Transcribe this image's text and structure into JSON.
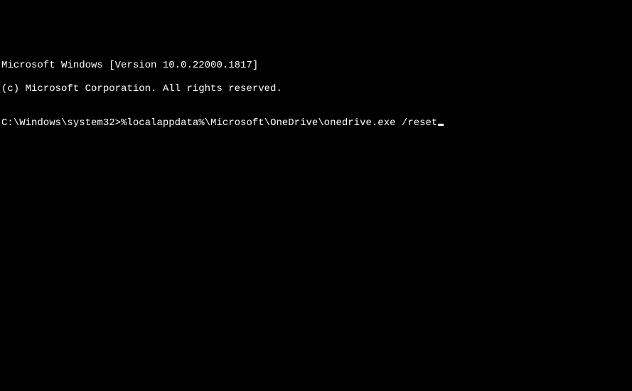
{
  "terminal": {
    "header_line1": "Microsoft Windows [Version 10.0.22000.1817]",
    "header_line2": "(c) Microsoft Corporation. All rights reserved.",
    "blank": "",
    "prompt": "C:\\Windows\\system32>",
    "command": "%localappdata%\\Microsoft\\OneDrive\\onedrive.exe /reset"
  }
}
